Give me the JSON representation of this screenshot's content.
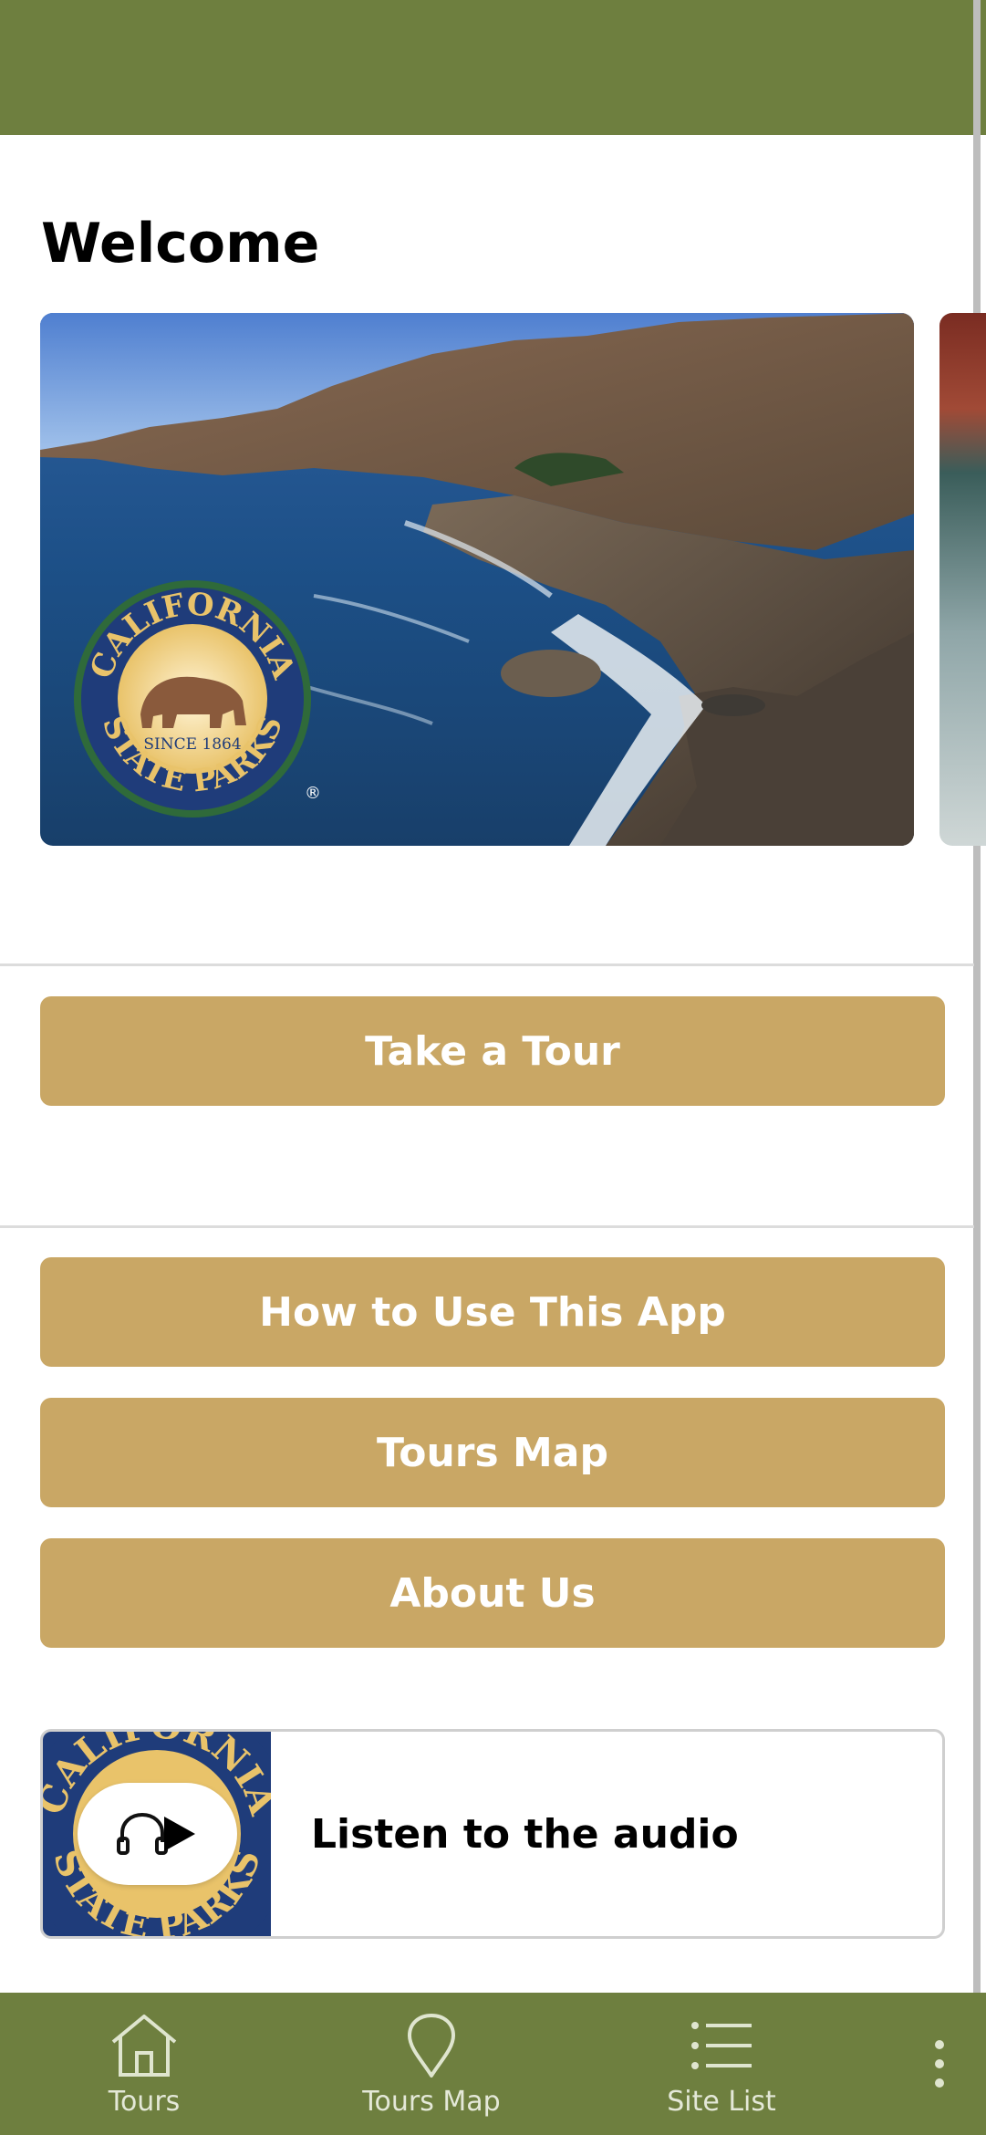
{
  "header": {
    "title": "Welcome"
  },
  "actions": {
    "take_tour": "Take a Tour",
    "how_to_use": "How to Use This App",
    "tours_map": "Tours Map",
    "about_us": "About Us"
  },
  "audio": {
    "label": "Listen to the audio"
  },
  "carousel": {
    "logo_text_top": "CALIFORNIA",
    "logo_text_bottom": "STATE PARKS",
    "logo_since": "SINCE 1864",
    "logo_mark": "®"
  },
  "bottom_nav": {
    "items": [
      {
        "label": "Tours",
        "icon": "home-icon"
      },
      {
        "label": "Tours Map",
        "icon": "map-pin-icon"
      },
      {
        "label": "Site List",
        "icon": "list-icon"
      }
    ],
    "more_icon": "more-vertical-icon"
  },
  "colors": {
    "brand_green": "#6e7f3f",
    "button_gold": "#c9a765",
    "logo_blue": "#1f3c7a",
    "logo_gold": "#e9c36a"
  }
}
